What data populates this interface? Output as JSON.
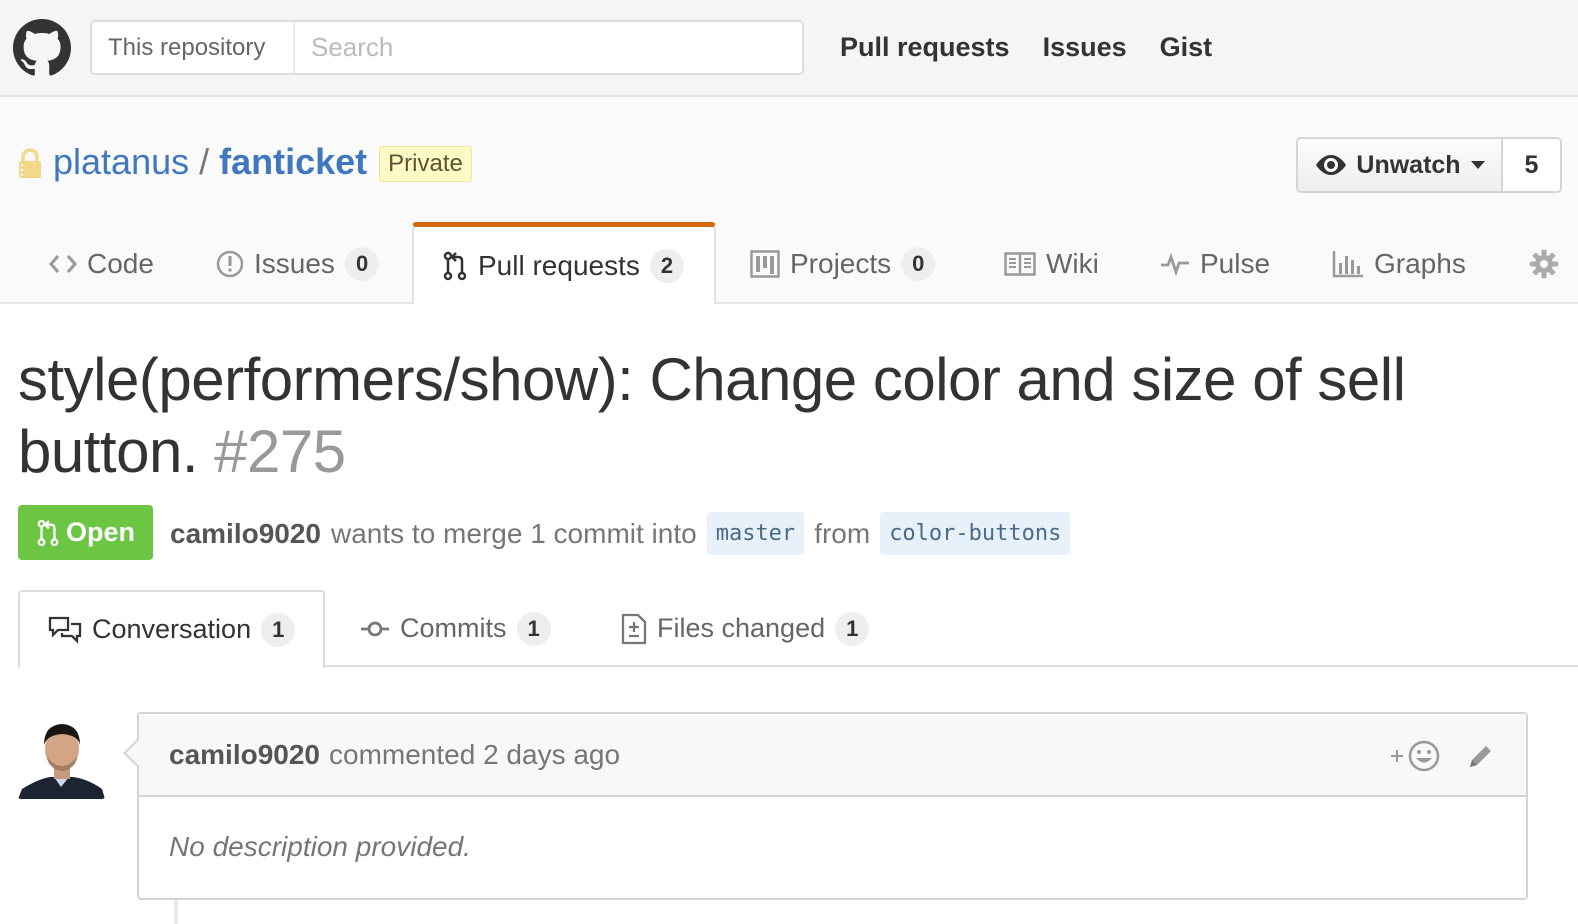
{
  "header": {
    "search_scope": "This repository",
    "search_placeholder": "Search",
    "nav": [
      "Pull requests",
      "Issues",
      "Gist"
    ]
  },
  "repo": {
    "owner": "platanus",
    "separator": "/",
    "name": "fanticket",
    "visibility": "Private",
    "watch_label": "Unwatch",
    "watch_count": "5"
  },
  "reponav": {
    "code": "Code",
    "issues": {
      "label": "Issues",
      "count": "0"
    },
    "pulls": {
      "label": "Pull requests",
      "count": "2"
    },
    "projects": {
      "label": "Projects",
      "count": "0"
    },
    "wiki": "Wiki",
    "pulse": "Pulse",
    "graphs": "Graphs"
  },
  "pr": {
    "title": "style(performers/show): Change color and size of sell button.",
    "number": "#275",
    "state": "Open",
    "author": "camilo9020",
    "merge_text": "wants to merge 1 commit into",
    "base_branch": "master",
    "from_text": "from",
    "head_branch": "color-buttons"
  },
  "tabs": {
    "conversation": {
      "label": "Conversation",
      "count": "1"
    },
    "commits": {
      "label": "Commits",
      "count": "1"
    },
    "files": {
      "label": "Files changed",
      "count": "1"
    }
  },
  "comment": {
    "author": "camilo9020",
    "action": "commented 2 days ago",
    "body": "No description provided."
  },
  "colors": {
    "link": "#4078c0",
    "open_green": "#6cc644",
    "selected_tab_accent": "#d26911"
  }
}
